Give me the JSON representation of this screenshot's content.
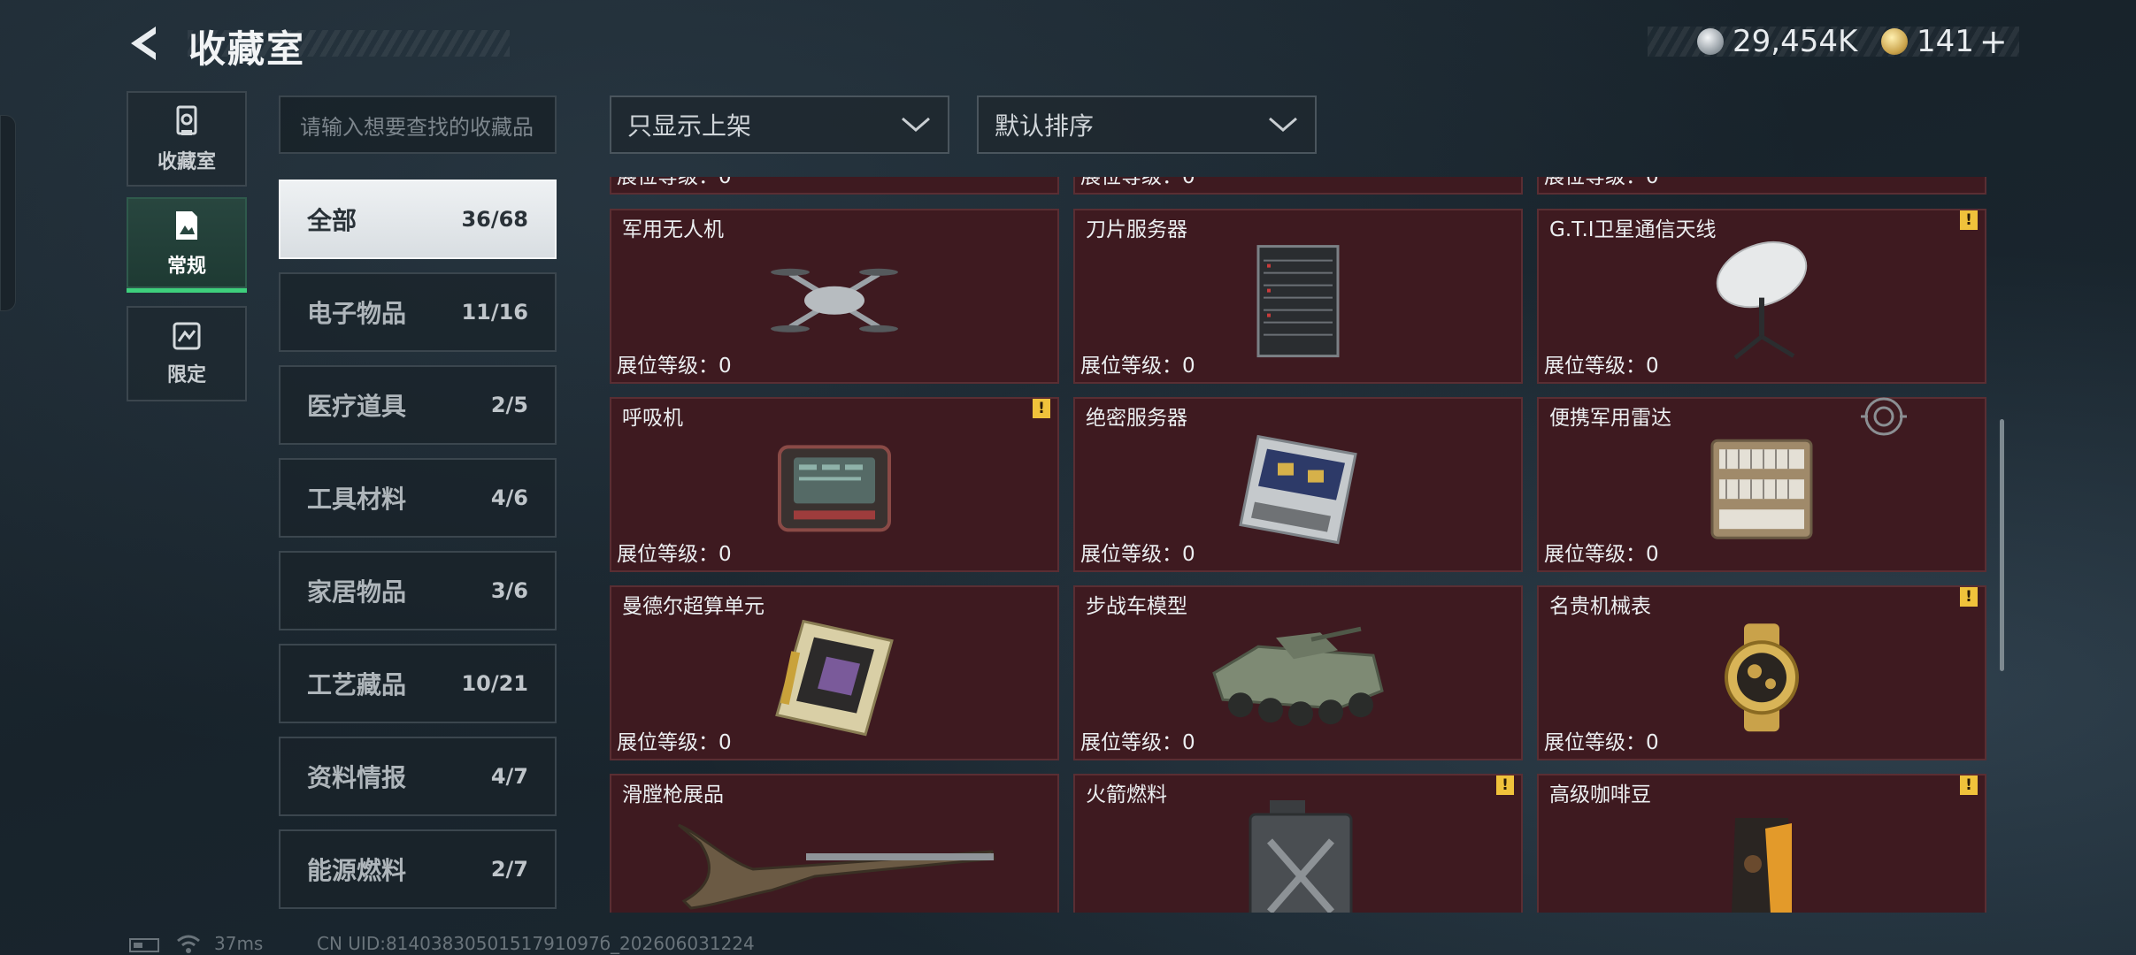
{
  "header": {
    "title": "收藏室"
  },
  "currency": [
    {
      "icon": "silver-coin-icon",
      "value": "29,454K"
    },
    {
      "icon": "gold-coin-icon",
      "value": "141"
    }
  ],
  "rail": [
    {
      "icon": "collection-room-icon",
      "label": "收藏室",
      "active": false
    },
    {
      "icon": "regular-icon",
      "label": "常规",
      "active": true
    },
    {
      "icon": "limited-icon",
      "label": "限定",
      "active": false
    }
  ],
  "search": {
    "placeholder": "请输入想要查找的收藏品"
  },
  "filters": {
    "show": "只显示上架",
    "sort": "默认排序"
  },
  "categories": [
    {
      "name": "全部",
      "count": "36/68"
    },
    {
      "name": "电子物品",
      "count": "11/16"
    },
    {
      "name": "医疗道具",
      "count": "2/5"
    },
    {
      "name": "工具材料",
      "count": "4/6"
    },
    {
      "name": "家居物品",
      "count": "3/6"
    },
    {
      "name": "工艺藏品",
      "count": "10/21"
    },
    {
      "name": "资料情报",
      "count": "4/7"
    },
    {
      "name": "能源燃料",
      "count": "2/7"
    }
  ],
  "level_label": "展位等级：0",
  "items": [
    {
      "name": "军用无人机",
      "warn": false,
      "icon": "drone-icon"
    },
    {
      "name": "刀片服务器",
      "warn": false,
      "icon": "blade-server-icon"
    },
    {
      "name": "G.T.I卫星通信天线",
      "warn": true,
      "icon": "satellite-antenna-icon"
    },
    {
      "name": "呼吸机",
      "warn": true,
      "icon": "ventilator-icon"
    },
    {
      "name": "绝密服务器",
      "warn": false,
      "icon": "secret-server-icon"
    },
    {
      "name": "便携军用雷达",
      "warn": false,
      "icon": "radar-icon"
    },
    {
      "name": "曼德尔超算单元",
      "warn": false,
      "icon": "supercompute-unit-icon"
    },
    {
      "name": "步战车模型",
      "warn": false,
      "icon": "ifv-model-icon"
    },
    {
      "name": "名贵机械表",
      "warn": true,
      "icon": "watch-icon"
    },
    {
      "name": "滑膛枪展品",
      "warn": false,
      "icon": "musket-icon"
    },
    {
      "name": "火箭燃料",
      "warn": true,
      "icon": "rocket-fuel-icon"
    },
    {
      "name": "高级咖啡豆",
      "warn": true,
      "icon": "coffee-beans-icon"
    }
  ],
  "footer": {
    "ping": "37ms",
    "uid": "CN UID:8140383050151791097б_202606031224"
  },
  "colors": {
    "accent": "#3ecf7c",
    "card_bg": "#3e1a20",
    "warning": "#f0c23b"
  }
}
